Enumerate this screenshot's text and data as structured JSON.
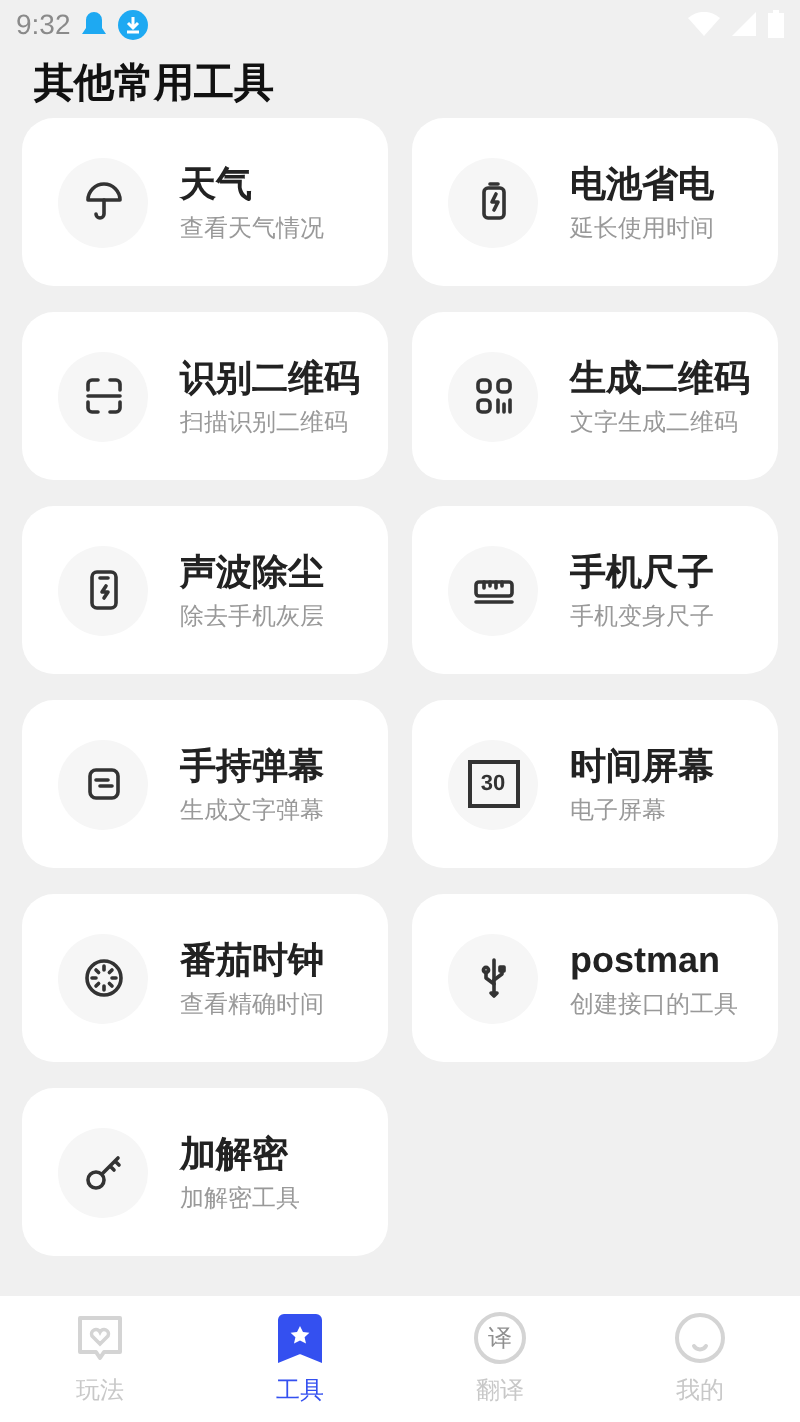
{
  "status_bar": {
    "time": "9:32"
  },
  "title": "其他常用工具",
  "tools": [
    {
      "kind": "umbrella",
      "name": "天气",
      "desc": "查看天气情况"
    },
    {
      "kind": "battery",
      "name": "电池省电",
      "desc": "延长使用时间"
    },
    {
      "kind": "scan",
      "name": "识别二维码",
      "desc": "扫描识别二维码"
    },
    {
      "kind": "qr",
      "name": "生成二维码",
      "desc": "文字生成二维码"
    },
    {
      "kind": "phone",
      "name": "声波除尘",
      "desc": "除去手机灰层"
    },
    {
      "kind": "ruler",
      "name": "手机尺子",
      "desc": "手机变身尺子"
    },
    {
      "kind": "message",
      "name": "手持弹幕",
      "desc": "生成文字弹幕"
    },
    {
      "kind": "calendar",
      "icon_text": "30",
      "name": "时间屏幕",
      "desc": "电子屏幕"
    },
    {
      "kind": "clock",
      "name": "番茄时钟",
      "desc": "查看精确时间"
    },
    {
      "kind": "usb",
      "name": "postman",
      "desc": "创建接口的工具"
    },
    {
      "kind": "key",
      "name": "加解密",
      "desc": "加解密工具"
    }
  ],
  "tabs": [
    {
      "kind": "heart",
      "label": "玩法",
      "selected": false
    },
    {
      "kind": "star",
      "label": "工具",
      "selected": true
    },
    {
      "kind": "glyph",
      "icon_text": "译",
      "label": "翻译",
      "selected": false
    },
    {
      "kind": "smile",
      "label": "我的",
      "selected": false
    }
  ]
}
